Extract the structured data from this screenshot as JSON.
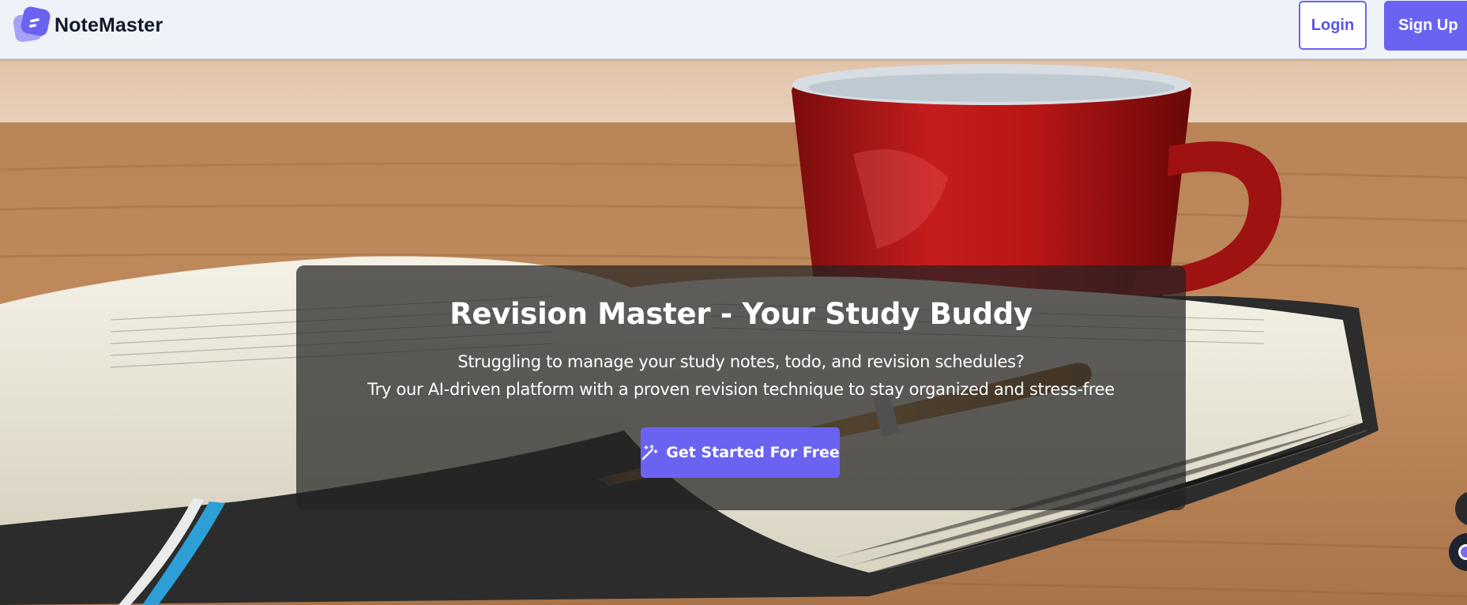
{
  "app": {
    "brand_name": "NoteMaster",
    "brand_icon": "note-logo-icon"
  },
  "nav": {
    "login_label": "Login",
    "signup_label": "Sign Up"
  },
  "hero": {
    "background": "photo of open book, pen and red coffee cup on wooden table",
    "title": "Revision Master - Your Study Buddy",
    "subtitle_line1": "Struggling to manage your study notes, todo, and revision schedules?",
    "subtitle_line2": "Try our AI-driven platform with a proven revision technique to stay organized and stress-free",
    "cta_label": "Get Started For Free",
    "cta_icon": "magic-wand-icon"
  },
  "widgets": {
    "chat_icon": "chat-bubble-icon",
    "assistant_icon": "assistant-avatar-icon"
  },
  "colors": {
    "accent": "#6a63f2",
    "navbar_bg": "#eff3f9",
    "card_overlay": "rgba(35,35,35,0.72)"
  }
}
